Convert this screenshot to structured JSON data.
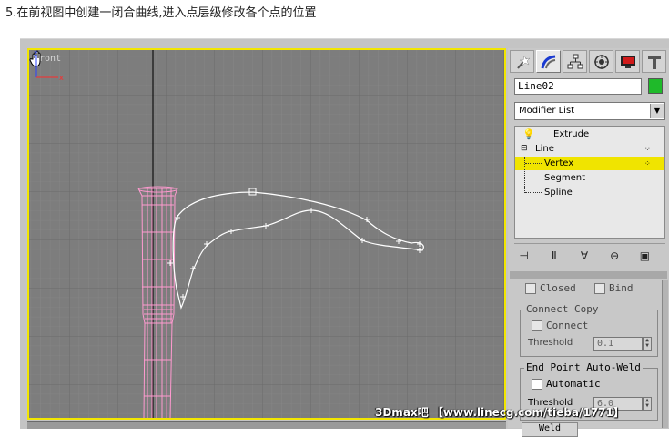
{
  "caption": "5.在前视图中创建一闭合曲线,进入点层级修改各个点的位置",
  "viewport": {
    "label": "Front",
    "axis_x": "x",
    "axis_z": "z"
  },
  "panel": {
    "tabs": [
      "create-icon",
      "modify-icon",
      "hierarchy-icon",
      "motion-icon",
      "display-icon",
      "utilities-icon"
    ],
    "object_name": "Line02",
    "object_color": "#1fba2a",
    "modifier_list": "Modifier List",
    "stack": {
      "extrude": "Extrude",
      "line": "Line",
      "vertex": "Vertex",
      "segment": "Segment",
      "spline": "Spline"
    },
    "rollout": {
      "closed": "Closed",
      "bind": "Bind",
      "connect_copy": "Connect Copy",
      "connect": "Connect",
      "threshold1_label": "Threshold",
      "threshold1_value": "0.1",
      "end_point_weld": "End Point Auto-Weld",
      "automatic": "Automatic",
      "threshold2_label": "Threshold",
      "threshold2_value": "6.0",
      "weld": "Weld"
    }
  },
  "watermark": "3Dmax吧 【www.linecg.com/tieba/1771】",
  "colors": {
    "selection": "#f0e400",
    "viewport_border": "#f2e600",
    "spline": "#ffffff",
    "column": "#ff9ad0"
  }
}
